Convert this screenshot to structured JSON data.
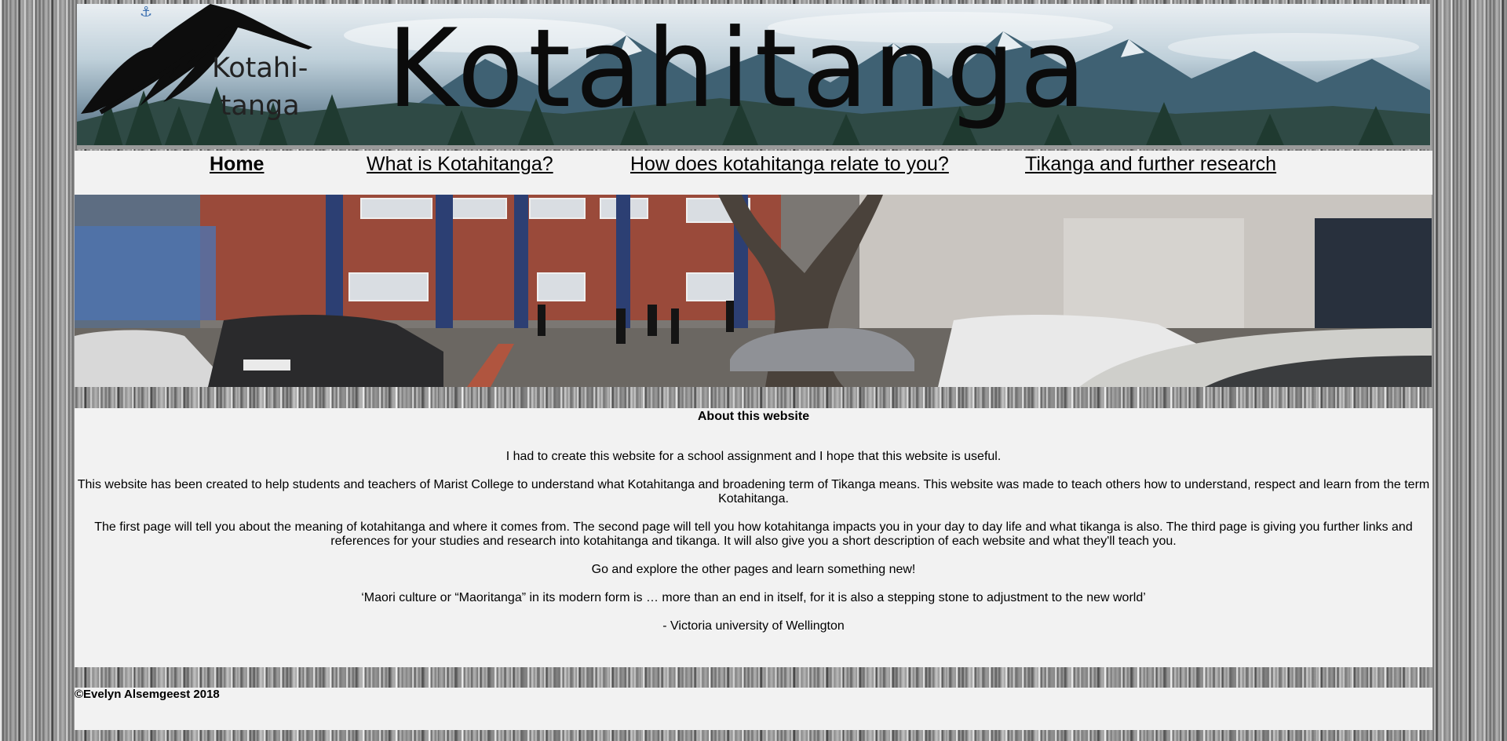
{
  "banner": {
    "small_title": "Kotahi-\ntanga",
    "big_title": "Kotahitanga",
    "anchor_icon": "anchor-icon"
  },
  "nav": {
    "items": [
      {
        "label": "Home",
        "active": true
      },
      {
        "label": "What is Kotahitanga?",
        "active": false
      },
      {
        "label": "How does kotahitanga relate to you?",
        "active": false
      },
      {
        "label": "Tikanga and further research",
        "active": false
      }
    ]
  },
  "about": {
    "heading": "About this website",
    "p1": "I had to create this website for a school assignment and I hope that this website is useful.",
    "p2a": "This website has been created to help students and teachers of Marist College to understand what Kotahitanga and broadening term of Tikanga means. This website was made to teach others how to understand, respect and learn from the term",
    "p2b": "Kotahitanga.",
    "p3a": "The first page will tell you about the meaning of kotahitanga and where it comes from. The second page will tell you how kotahitanga impacts you in your day to day life and what tikanga is also. The third page is giving you further links and",
    "p3b": "references for your studies and research into kotahitanga and tikanga. It will also give you a short description of each website and what they'll teach you.",
    "p4": "Go and explore the other pages and learn something new!",
    "quote": "‘Maori culture or “Maoritanga” in its modern form is … more than an end in itself, for it is also a stepping stone to adjustment to the new world’",
    "attribution": "- Victoria university of Wellington"
  },
  "footer": {
    "copyright": "©Evelyn Alsemgeest 2018"
  },
  "colors": {
    "panel_bg": "#f2f2f2",
    "text": "#000000"
  }
}
